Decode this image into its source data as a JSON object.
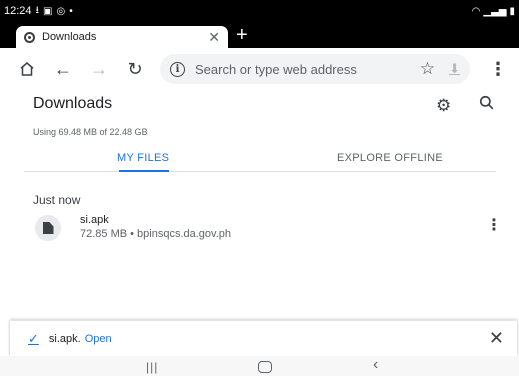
{
  "status_bar": {
    "time": "12:24",
    "left_icons": [
      "download-done-icon",
      "image-icon",
      "chrome-icon",
      "dot-icon"
    ],
    "right_icons": [
      "wifi-icon",
      "signal-icon",
      "battery-icon"
    ]
  },
  "browser": {
    "tab_title": "Downloads",
    "omnibox_placeholder": "Search or type web address"
  },
  "page": {
    "title": "Downloads",
    "storage_info": "Using 69.48 MB of 22.48 GB",
    "tabs": [
      {
        "label": "MY FILES",
        "active": true
      },
      {
        "label": "EXPLORE OFFLINE",
        "active": false
      }
    ],
    "section_label": "Just now",
    "files": [
      {
        "name": "si.apk",
        "meta": "72.85 MB • bpinsqcs.da.gov.ph",
        "icon": "file-icon"
      }
    ]
  },
  "snackbar": {
    "text": "si.apk.",
    "action": "Open"
  },
  "colors": {
    "accent": "#1a73e8",
    "status_bar": "#000000",
    "omnibox_bg": "#f1f3f4"
  }
}
